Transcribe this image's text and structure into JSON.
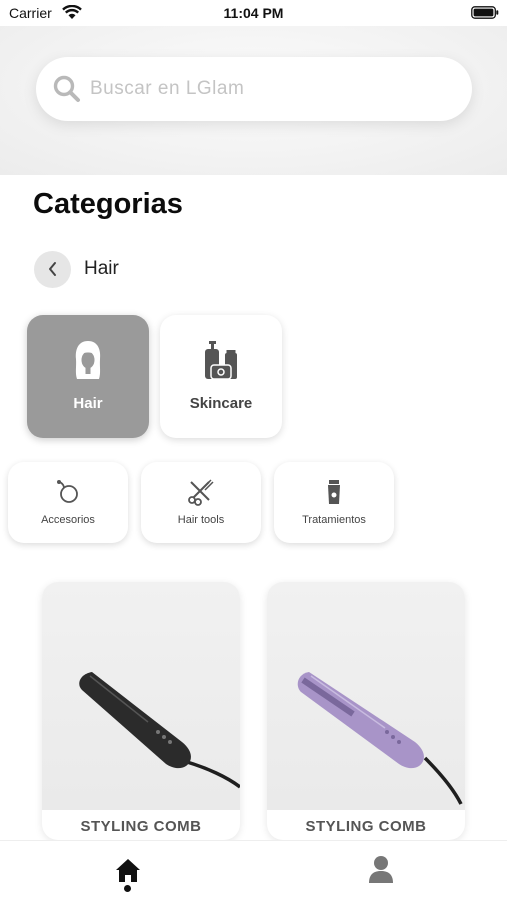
{
  "status_bar": {
    "carrier": "Carrier",
    "time": "11:04 PM"
  },
  "search": {
    "placeholder": "Buscar en LGlam",
    "value": ""
  },
  "page_title": "Categorias",
  "breadcrumb": {
    "current": "Hair"
  },
  "categories": [
    {
      "label": "Hair",
      "icon": "hair-icon",
      "selected": true
    },
    {
      "label": "Skincare",
      "icon": "skincare-icon",
      "selected": false
    }
  ],
  "subcategories": [
    {
      "label": "Accesorios",
      "icon": "accessories-icon"
    },
    {
      "label": "Hair tools",
      "icon": "hair-tools-icon"
    },
    {
      "label": "Tratamientos",
      "icon": "treatments-icon"
    }
  ],
  "products": [
    {
      "name": "STYLING COMB",
      "color": "#2b2b2b"
    },
    {
      "name": "STYLING COMB",
      "color": "#a894c8"
    }
  ],
  "tab_bar": {
    "active": "home-icon",
    "items": [
      "home-icon",
      "profile-icon"
    ]
  },
  "colors": {
    "selected_tile": "#9a9a9a",
    "background": "#ffffff"
  }
}
